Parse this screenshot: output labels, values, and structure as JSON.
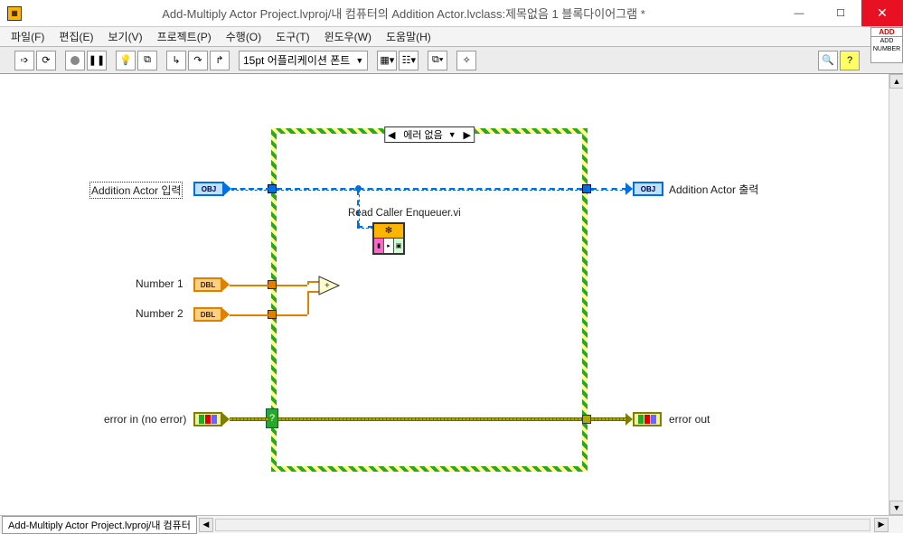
{
  "window": {
    "title": "Add-Multiply Actor Project.lvproj/내 컴퓨터의 Addition Actor.lvclass:제목없음 1 블록다이어그램 *"
  },
  "menu": {
    "file": "파일(F)",
    "edit": "편집(E)",
    "view": "보기(V)",
    "project": "프로젝트(P)",
    "operate": "수행(O)",
    "tools": "도구(T)",
    "window": "윈도우(W)",
    "help": "도움말(H)"
  },
  "toolbar": {
    "font": "15pt 어플리케이션 폰트"
  },
  "nav_icon": {
    "add": "ADD",
    "number": "ADD NUMBER"
  },
  "case": {
    "label": "에러 없음"
  },
  "terminals": {
    "actor_in": "Addition Actor 입력",
    "actor_out": "Addition Actor 출력",
    "obj": "OBJ",
    "num1": "Number 1",
    "num2": "Number 2",
    "dbl": "DBL",
    "err_in": "error in (no error)",
    "err_out": "error out"
  },
  "subvi": {
    "label": "Read Caller Enqueuer.vi"
  },
  "status": {
    "tab": "Add-Multiply Actor Project.lvproj/내 컴퓨터"
  }
}
